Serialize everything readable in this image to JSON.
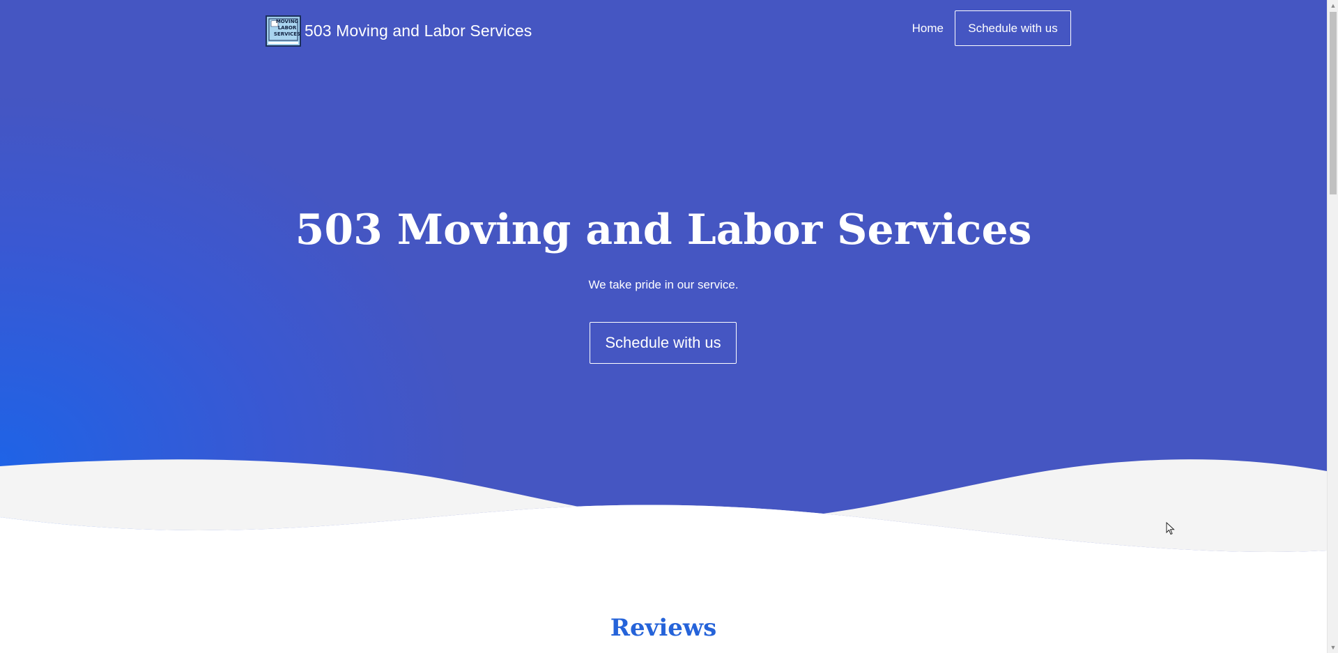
{
  "header": {
    "brand_name": "503 Moving and Labor Services",
    "logo_text": [
      "MOVING",
      "LABOR",
      "SERVICES"
    ],
    "nav": {
      "home_label": "Home",
      "cta_label": "Schedule with us"
    }
  },
  "hero": {
    "title": "503 Moving and Labor Services",
    "tagline": "We take pride in our service.",
    "cta_label": "Schedule with us"
  },
  "sections": {
    "reviews_title": "Reviews"
  },
  "colors": {
    "hero_primary": "#4556c2",
    "hero_accent": "#1f63e6",
    "wave_light": "#f4f4f4",
    "section_title": "#2563d9"
  },
  "icons": {
    "logo": "moving-labor-logo",
    "scroll_up": "chevron-up-icon",
    "scroll_down": "chevron-down-icon",
    "cursor": "mouse-pointer-icon"
  }
}
